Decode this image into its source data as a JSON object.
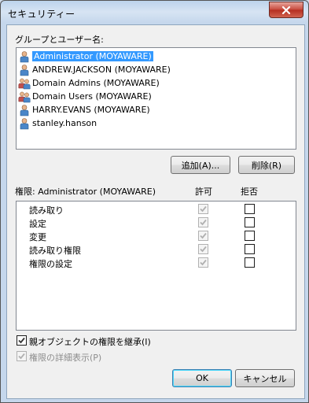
{
  "window": {
    "title": "セキュリティー"
  },
  "groups": {
    "label": "グループとユーザー名:",
    "items": [
      {
        "label": "Administrator (MOYAWARE)",
        "kind": "user",
        "selected": true
      },
      {
        "label": "ANDREW.JACKSON (MOYAWARE)",
        "kind": "user",
        "selected": false
      },
      {
        "label": "Domain Admins (MOYAWARE)",
        "kind": "group",
        "selected": false
      },
      {
        "label": "Domain Users (MOYAWARE)",
        "kind": "group",
        "selected": false
      },
      {
        "label": "HARRY.EVANS (MOYAWARE)",
        "kind": "user",
        "selected": false
      },
      {
        "label": "stanley.hanson",
        "kind": "user",
        "selected": false
      }
    ]
  },
  "buttons": {
    "add": "追加(A)...",
    "remove": "削除(R)",
    "ok": "OK",
    "cancel": "キャンセル"
  },
  "permissions": {
    "label": "権限: Administrator (MOYAWARE)",
    "allow_header": "許可",
    "deny_header": "拒否",
    "rows": [
      {
        "name": "読み取り",
        "allow": true,
        "deny": false
      },
      {
        "name": "設定",
        "allow": true,
        "deny": false
      },
      {
        "name": "変更",
        "allow": true,
        "deny": false
      },
      {
        "name": "読み取り権限",
        "allow": true,
        "deny": false
      },
      {
        "name": "権限の設定",
        "allow": true,
        "deny": false
      }
    ]
  },
  "options": {
    "inherit": {
      "label": "親オブジェクトの権限を継承(I)",
      "checked": true
    },
    "advanced": {
      "label": "権限の詳細表示(P)",
      "checked": true,
      "disabled": true
    }
  },
  "colors": {
    "selection": "#3399ff",
    "close_button": "#c7473a"
  },
  "icons": {
    "user": "user-icon",
    "group": "group-icon",
    "close": "close-icon",
    "check": "check-icon"
  }
}
